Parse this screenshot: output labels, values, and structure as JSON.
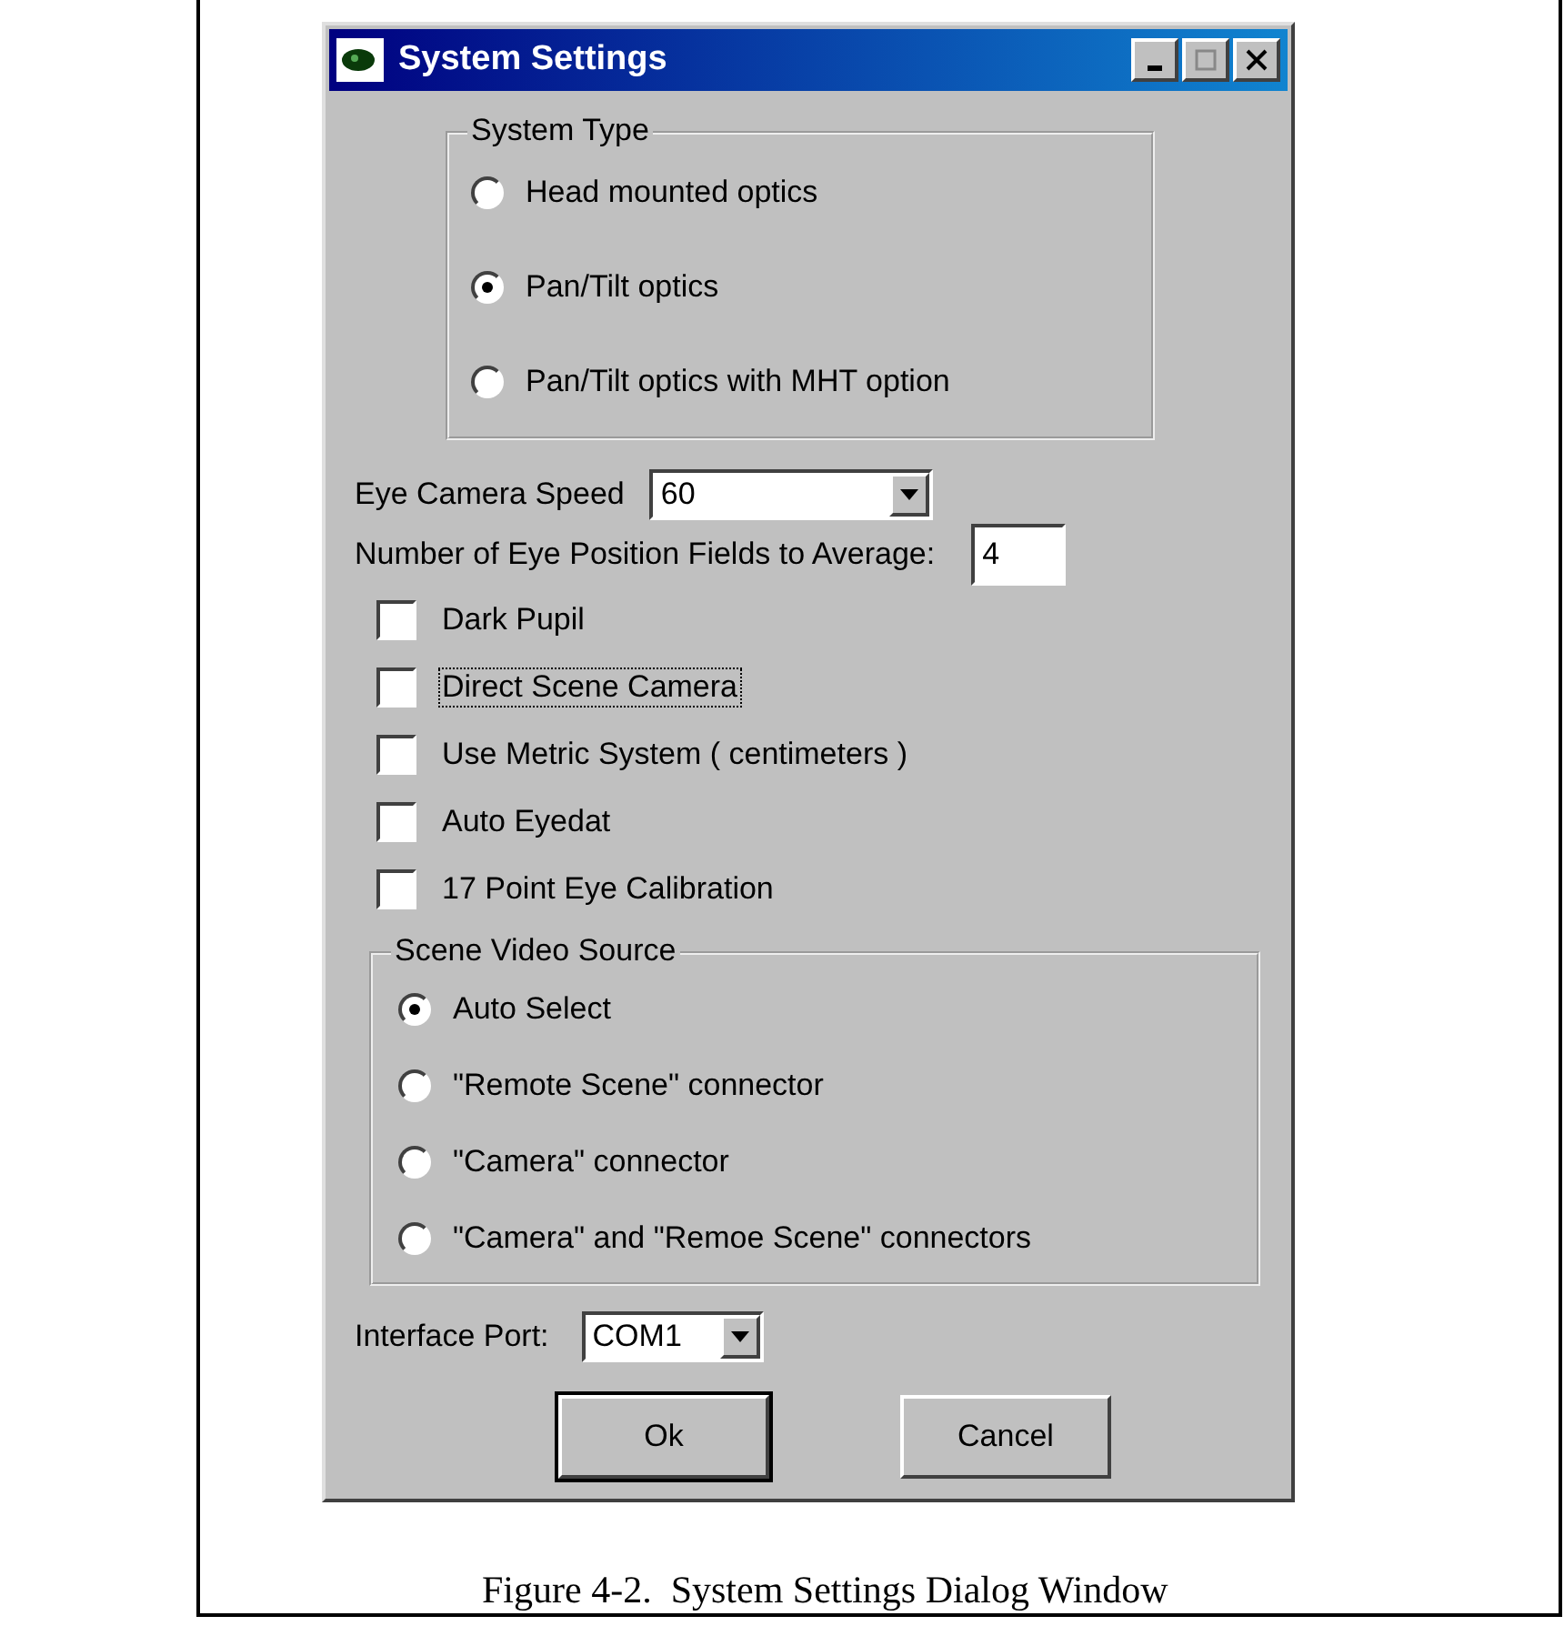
{
  "window": {
    "title": "System Settings"
  },
  "system_type": {
    "label": "System Type",
    "options": [
      {
        "label": "Head mounted optics",
        "selected": false
      },
      {
        "label": "Pan/Tilt optics",
        "selected": true
      },
      {
        "label": "Pan/Tilt optics with MHT option",
        "selected": false
      }
    ]
  },
  "eye_camera_speed": {
    "label": "Eye Camera Speed",
    "value": "60"
  },
  "fields_to_average": {
    "label": "Number of Eye Position Fields to Average:",
    "value": "4"
  },
  "checkboxes": [
    {
      "label": "Dark Pupil",
      "checked": false,
      "focused": false
    },
    {
      "label": "Direct Scene Camera",
      "checked": false,
      "focused": true
    },
    {
      "label": "Use Metric System ( centimeters )",
      "checked": false,
      "focused": false
    },
    {
      "label": "Auto Eyedat",
      "checked": false,
      "focused": false
    },
    {
      "label": "17 Point Eye Calibration",
      "checked": false,
      "focused": false
    }
  ],
  "scene_video_source": {
    "label": "Scene Video Source",
    "options": [
      {
        "label": "Auto Select",
        "selected": true
      },
      {
        "label": "\"Remote Scene\" connector",
        "selected": false
      },
      {
        "label": "\"Camera\" connector",
        "selected": false
      },
      {
        "label": "\"Camera\" and \"Remoe Scene\" connectors",
        "selected": false
      }
    ]
  },
  "interface_port": {
    "label": "Interface Port:",
    "value": "COM1"
  },
  "buttons": [
    {
      "label": "Ok",
      "default": true
    },
    {
      "label": "Cancel",
      "default": false
    }
  ],
  "caption": "Figure 4-2.  System Settings Dialog Window"
}
